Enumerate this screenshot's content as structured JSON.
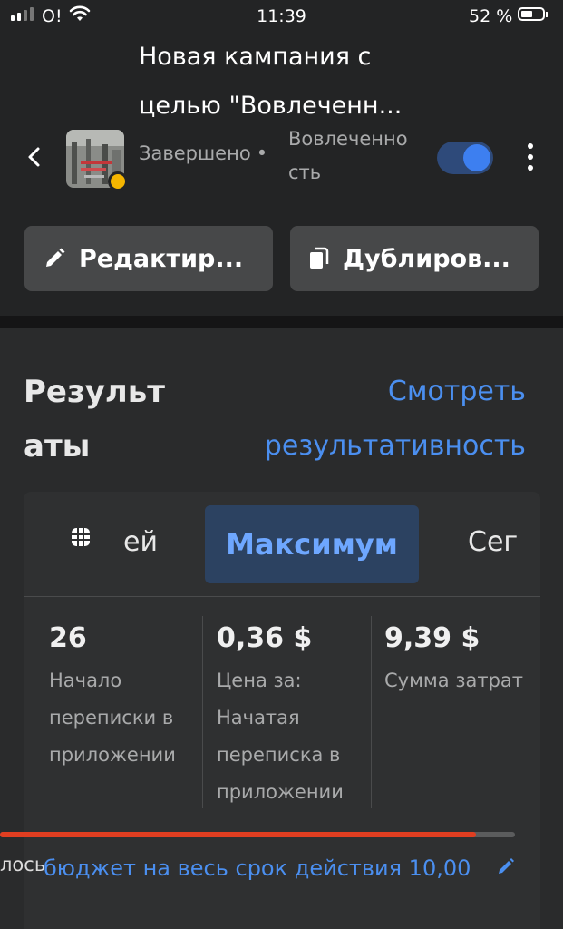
{
  "status_bar": {
    "carrier": "O!",
    "time": "11:39",
    "battery": "52 %",
    "battery_level": 0.52
  },
  "header": {
    "title": "Новая кампания с целью \"Вовлеченн...",
    "status": "Завершено",
    "bullet": "•",
    "objective": "Вовлеченно сть",
    "toggle_on": true,
    "icons": {
      "back": "chevron-left-icon",
      "more": "more-vertical-icon"
    }
  },
  "actions": {
    "edit_label": "Редактир...",
    "duplicate_label": "Дублиров..."
  },
  "results": {
    "title": "Результ аты",
    "view_link": "Смотреть результативность",
    "tabs": {
      "left_fragment": "ей",
      "active": "Максимум",
      "right_fragment": "Сег"
    },
    "metrics": [
      {
        "value": "26",
        "label": "Начало переписки в приложении"
      },
      {
        "value": "0,36 $",
        "label": "Цена за: Начатая переписка в приложении"
      },
      {
        "value": "9,39 $",
        "label": "Сумма затрат"
      }
    ],
    "progress_fraction": 0.92,
    "spent_fragment": "лось",
    "budget_text": "бюджет на весь срок действия 10,00"
  },
  "colors": {
    "accent": "#4b8ff0",
    "progress": "#e03e21",
    "status_dot": "#f4b500",
    "active_tab_bg": "#2c4261"
  }
}
